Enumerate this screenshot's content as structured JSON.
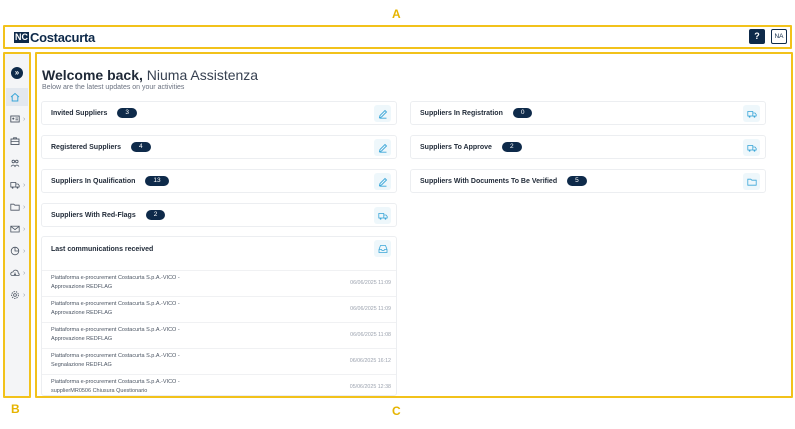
{
  "annotations": {
    "a": "A",
    "b": "B",
    "c": "C"
  },
  "header": {
    "logo_mark": "NC",
    "logo_text": "Costacurta",
    "help_label": "?",
    "user_initials": "NA"
  },
  "sidebar": {
    "items": [
      {
        "icon": "home-icon"
      },
      {
        "icon": "id-card-icon"
      },
      {
        "icon": "briefcase-icon"
      },
      {
        "icon": "users-icon"
      },
      {
        "icon": "truck-icon"
      },
      {
        "icon": "folder-icon"
      },
      {
        "icon": "mail-icon"
      },
      {
        "icon": "chart-pie-icon"
      },
      {
        "icon": "cloud-download-icon"
      },
      {
        "icon": "gear-icon"
      }
    ]
  },
  "main": {
    "welcome_bold": "Welcome back,",
    "welcome_name": "Niuma Assistenza",
    "subtitle": "Below are the latest updates on your activities",
    "left_cards": [
      {
        "label": "Invited Suppliers",
        "count": "3",
        "icon": "edit-icon"
      },
      {
        "label": "Registered Suppliers",
        "count": "4",
        "icon": "edit-icon"
      },
      {
        "label": "Suppliers In Qualification",
        "count": "13",
        "icon": "edit-icon"
      },
      {
        "label": "Suppliers With Red-Flags",
        "count": "2",
        "icon": "truck-icon"
      }
    ],
    "right_cards": [
      {
        "label": "Suppliers In Registration",
        "count": "0",
        "icon": "truck-icon"
      },
      {
        "label": "Suppliers To Approve",
        "count": "2",
        "icon": "truck-icon"
      },
      {
        "label": "Suppliers With Documents To Be Verified",
        "count": "5",
        "icon": "folder-icon"
      }
    ],
    "communications": {
      "title": "Last communications received",
      "messages": [
        {
          "line1": "Piattaforma e-procurement Costacurta S.p.A.-VICO -",
          "line2": "Approvazione REDFLAG",
          "date": "06/06/2025 11:09"
        },
        {
          "line1": "Piattaforma e-procurement Costacurta S.p.A.-VICO -",
          "line2": "Approvazione REDFLAG",
          "date": "06/06/2025 11:09"
        },
        {
          "line1": "Piattaforma e-procurement Costacurta S.p.A.-VICO -",
          "line2": "Approvazione REDFLAG",
          "date": "06/06/2025 11:08"
        },
        {
          "line1": "Piattaforma e-procurement Costacurta S.p.A.-VICO -",
          "line2": "Segnalazione REDFLAG",
          "date": "06/06/2025 16:12"
        },
        {
          "line1": "Piattaforma e-procurement Costacurta S.p.A.-VICO -",
          "line2": "supplierMR0506 Chiusura Questionario",
          "date": "05/06/2025 12:38"
        }
      ]
    }
  },
  "colors": {
    "annotation": "#f2c21b",
    "brand": "#0e2a4a",
    "accent_icon": "#3aa6d8"
  }
}
